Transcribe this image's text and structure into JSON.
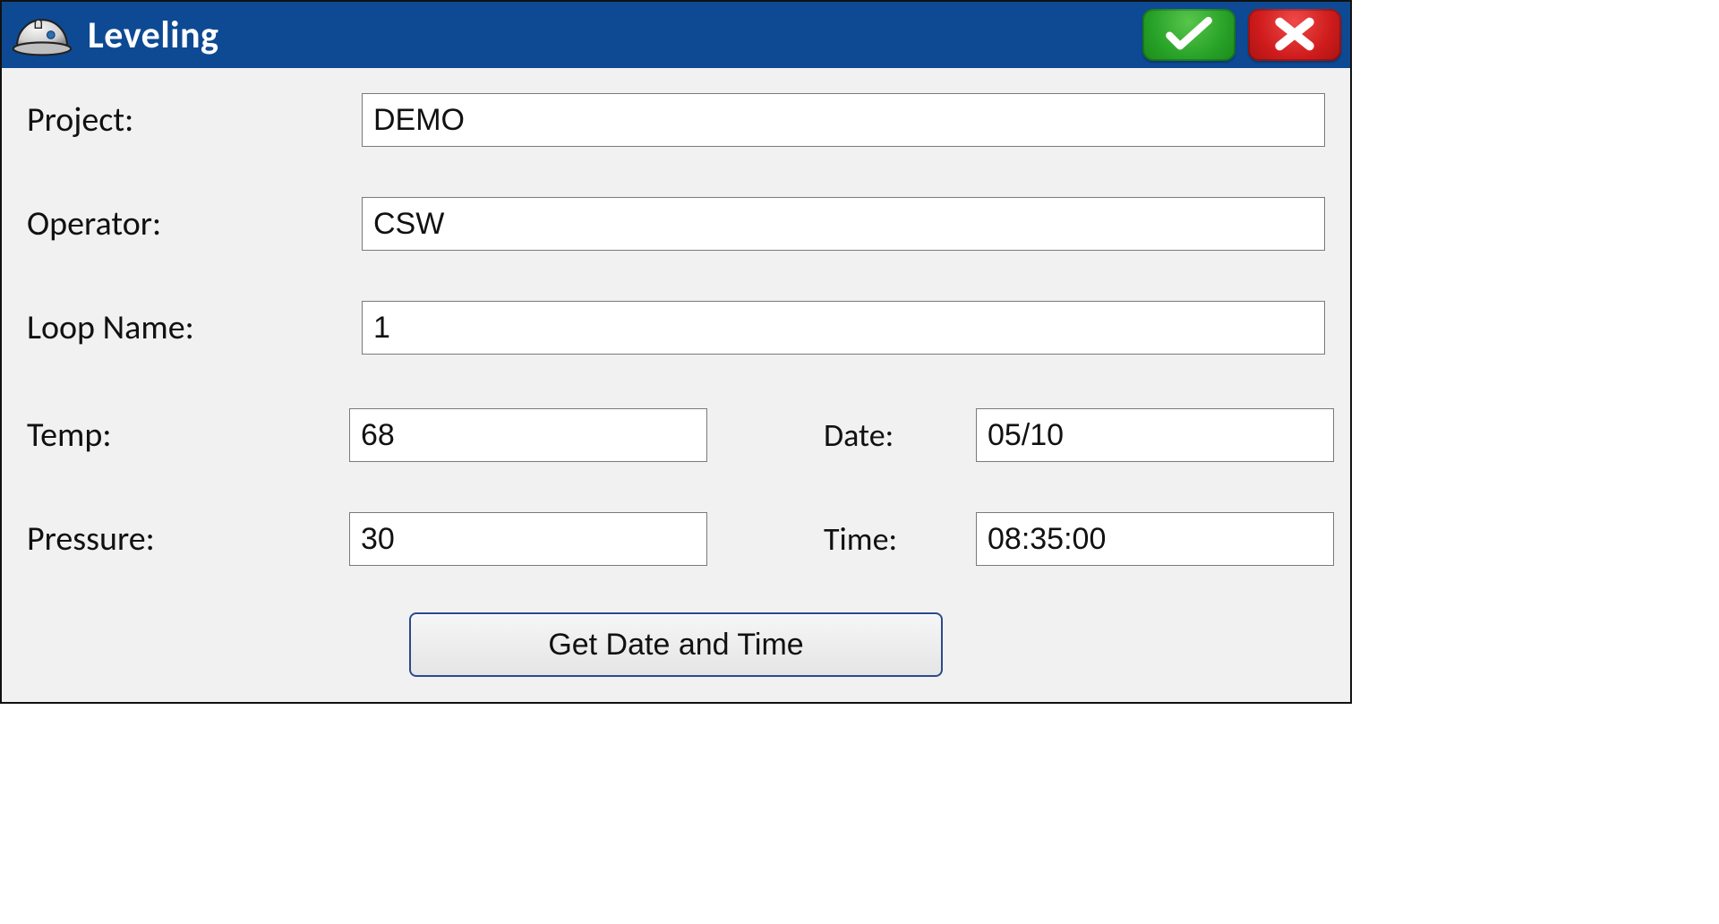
{
  "header": {
    "title": "Leveling",
    "icon_name": "hardhat-icon",
    "ok_icon": "checkmark-icon",
    "cancel_icon": "x-icon"
  },
  "form": {
    "project_label": "Project:",
    "project_value": "DEMO",
    "operator_label": "Operator:",
    "operator_value": "CSW",
    "loop_name_label": "Loop Name:",
    "loop_name_value": "1",
    "temp_label": "Temp:",
    "temp_value": "68",
    "date_label": "Date:",
    "date_value": "05/10",
    "pressure_label": "Pressure:",
    "pressure_value": "30",
    "time_label": "Time:",
    "time_value": "08:35:00",
    "get_date_time_label": "Get Date and Time"
  },
  "colors": {
    "titlebar_bg": "#0e4a93",
    "ok_green": "#28a228",
    "cancel_red": "#cf1b1b"
  }
}
